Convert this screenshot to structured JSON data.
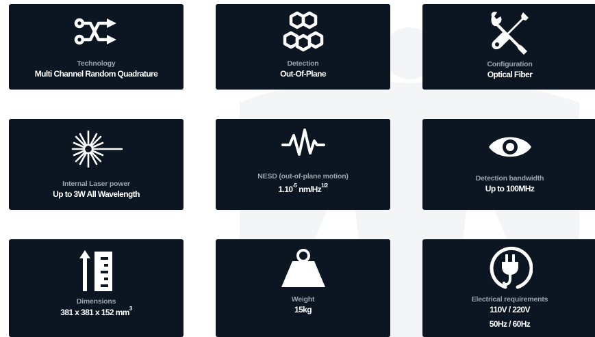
{
  "specs": [
    {
      "icon": "branch-icon",
      "label": "Technology",
      "value": "Multi Channel Random Quadrature"
    },
    {
      "icon": "hexagon-cluster-icon",
      "label": "Detection",
      "value": "Out-Of-Plane"
    },
    {
      "icon": "tools-icon",
      "label": "Configuration",
      "value": "Optical Fiber"
    },
    {
      "icon": "laser-burst-icon",
      "label": "Internal Laser power",
      "value": "Up to 3W All Wavelength"
    },
    {
      "icon": "waveform-icon",
      "label": "NESD (out-of-plane motion)",
      "value_parts": {
        "base": "1.10",
        "exp": "-5",
        "unit": "nm/Hz",
        "unit_exp": "1/2"
      }
    },
    {
      "icon": "eye-icon",
      "label": "Detection bandwidth",
      "value": "Up to 100MHz"
    },
    {
      "icon": "ruler-arrow-icon",
      "label": "Dimensions",
      "value_parts": {
        "text": "381 x 381 x 152 mm",
        "exp": "3"
      }
    },
    {
      "icon": "weight-icon",
      "label": "Weight",
      "value": "15kg"
    },
    {
      "icon": "power-plug-icon",
      "label": "Electrical requirements",
      "value": "110V / 220V",
      "value2": "50Hz / 60Hz"
    }
  ],
  "colors": {
    "card_background": "#0b1622",
    "label_text": "#9aa3ad",
    "value_text": "#ffffff",
    "page_background": "#ffffff"
  }
}
